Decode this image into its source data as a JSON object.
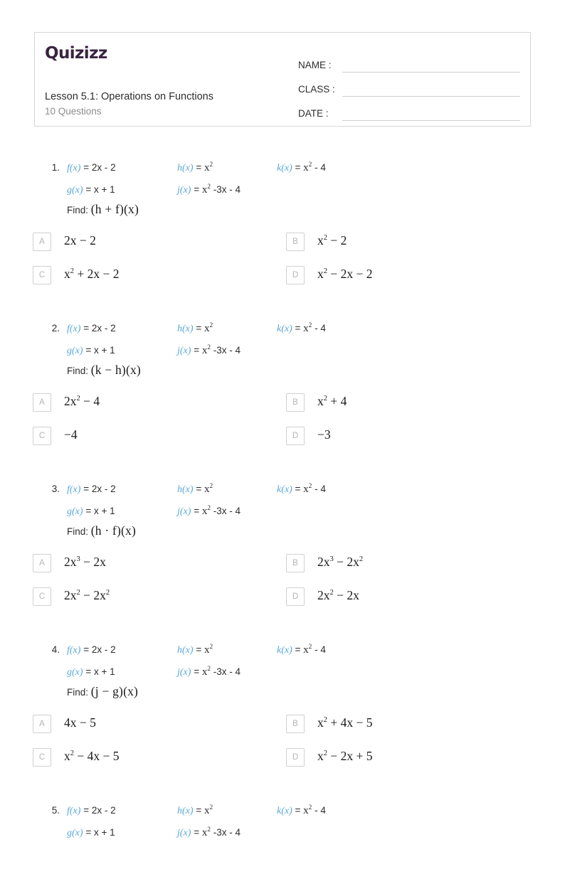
{
  "header": {
    "logo": "Quizizz",
    "title": "Lesson 5.1: Operations on Functions",
    "question_count": "10 Questions",
    "fields": [
      {
        "label": "NAME :",
        "value": ""
      },
      {
        "label": "CLASS :",
        "value": ""
      },
      {
        "label": "DATE  :",
        "value": ""
      }
    ]
  },
  "accent_colors": {
    "logo_purple": "#3b2440",
    "logo_dot_pink": "#b5275c",
    "function_blue": "#5ba8d8",
    "box_border": "#d6d6d6",
    "letter_gray": "#b4b4b4",
    "subtitle_gray": "#8c8c8c"
  },
  "function_definitions": {
    "f": {
      "name": "f(x)",
      "equals": "=",
      "body": "2x - 2"
    },
    "g": {
      "name": "g(x)",
      "equals": "=",
      "body": "x + 1"
    },
    "h": {
      "name": "h(x)",
      "equals": "=",
      "base": "x",
      "exp": "2",
      "tail": ""
    },
    "j": {
      "name": "j(x)",
      "equals": "=",
      "base": "x",
      "exp": "2",
      "tail": "-3x - 4"
    },
    "k": {
      "name": "k(x)",
      "equals": "=",
      "base": "x",
      "exp": "2",
      "tail": "- 4"
    }
  },
  "find_label": "Find:",
  "questions": [
    {
      "number": "1.",
      "prompt": "(h + f)(x)",
      "options": [
        {
          "letter": "A",
          "text": "2x − 2"
        },
        {
          "letter": "B",
          "text": "x² − 2"
        },
        {
          "letter": "C",
          "text": "x² + 2x − 2"
        },
        {
          "letter": "D",
          "text": "x² − 2x − 2"
        }
      ]
    },
    {
      "number": "2.",
      "prompt": "(k − h)(x)",
      "options": [
        {
          "letter": "A",
          "text": "2x² − 4"
        },
        {
          "letter": "B",
          "text": "x² + 4"
        },
        {
          "letter": "C",
          "text": "−4"
        },
        {
          "letter": "D",
          "text": "−3"
        }
      ]
    },
    {
      "number": "3.",
      "prompt": "(h · f)(x)",
      "options": [
        {
          "letter": "A",
          "text": "2x³ − 2x"
        },
        {
          "letter": "B",
          "text": "2x³ − 2x²"
        },
        {
          "letter": "C",
          "text": "2x² − 2x²"
        },
        {
          "letter": "D",
          "text": "2x² − 2x"
        }
      ]
    },
    {
      "number": "4.",
      "prompt": "(j − g)(x)",
      "options": [
        {
          "letter": "A",
          "text": "4x − 5"
        },
        {
          "letter": "B",
          "text": "x² + 4x − 5"
        },
        {
          "letter": "C",
          "text": "x² − 4x − 5"
        },
        {
          "letter": "D",
          "text": "x² − 2x + 5"
        }
      ]
    },
    {
      "number": "5.",
      "prompt": "",
      "options": []
    }
  ]
}
